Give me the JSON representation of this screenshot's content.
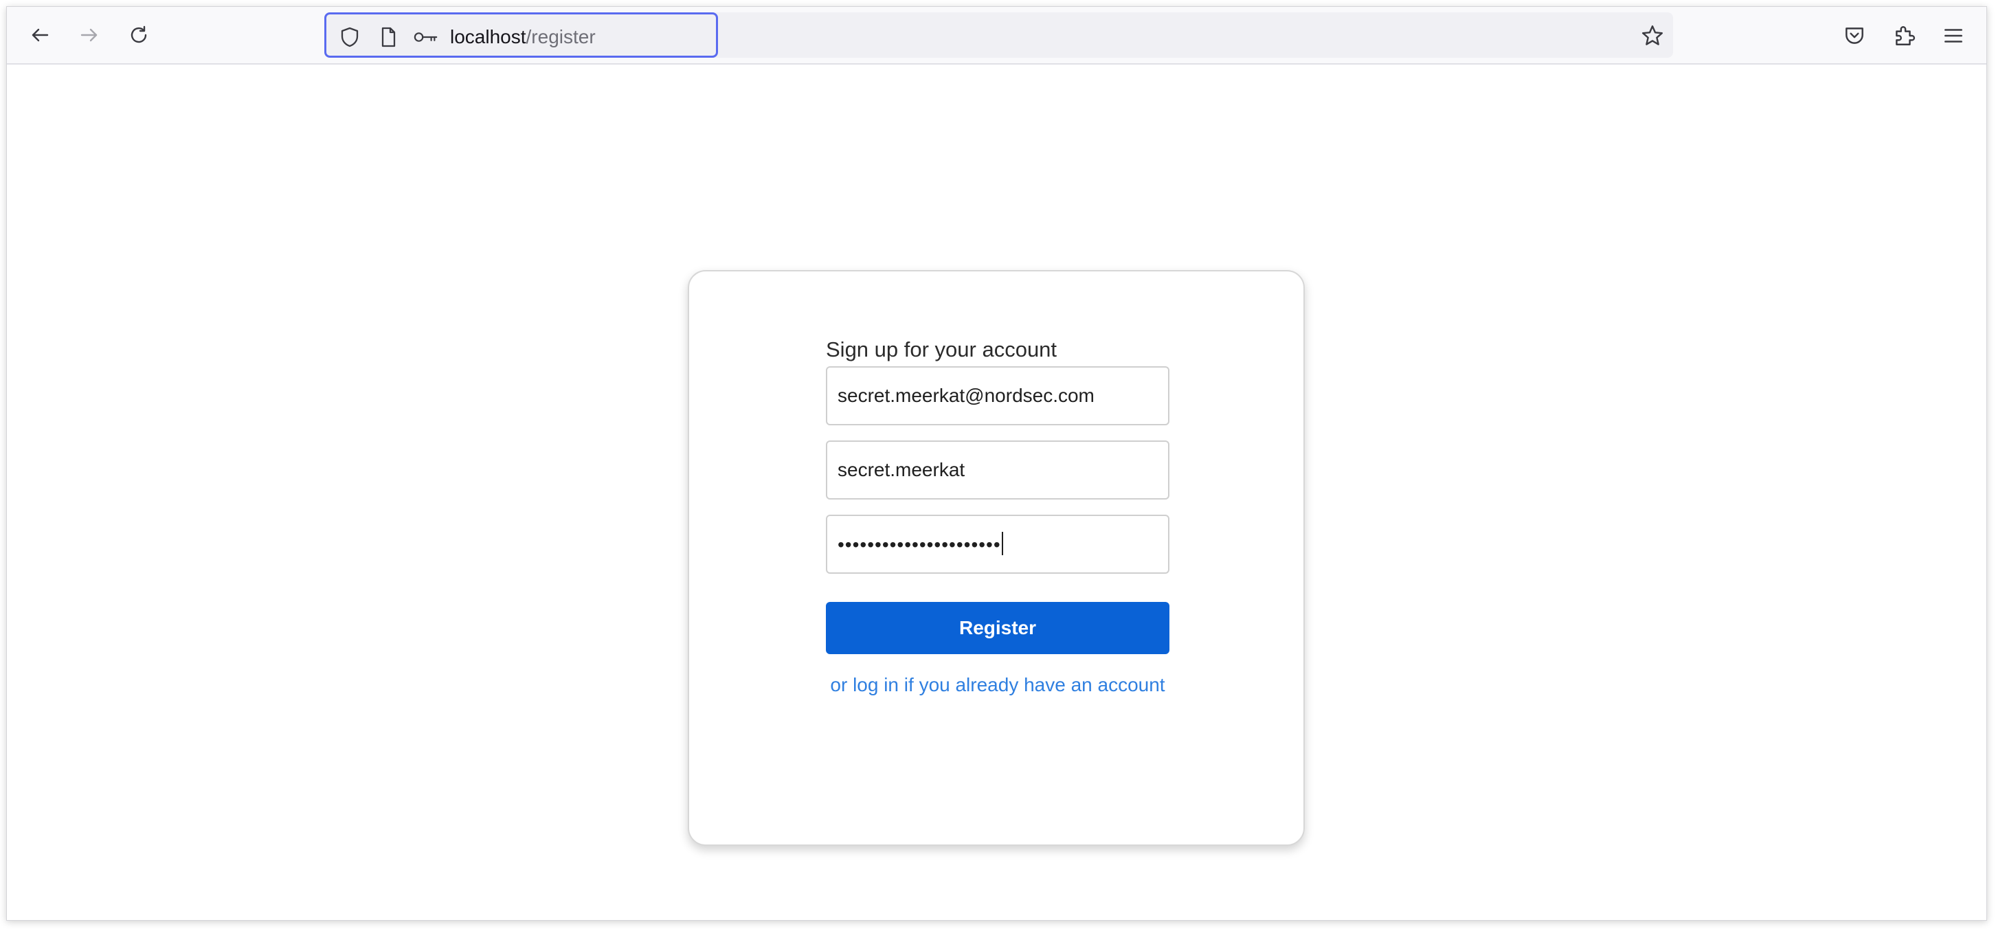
{
  "browser": {
    "url_host": "localhost",
    "url_path": "/register",
    "icons": {
      "back": "back-arrow-icon",
      "forward": "forward-arrow-icon",
      "reload": "reload-icon",
      "tracking_protection": "shield-icon",
      "page_info": "page-icon",
      "saved_logins": "key-icon",
      "bookmark": "star-icon",
      "pocket": "pocket-icon",
      "extensions": "puzzle-icon",
      "menu": "hamburger-menu-icon"
    },
    "focus_color": "#5a6bf0"
  },
  "form": {
    "heading": "Sign up for your account",
    "email_value": "secret.meerkat@nordsec.com",
    "username_value": "secret.meerkat",
    "password_masked": "••••••••••••••••••••••",
    "register_label": "Register",
    "login_link": "or log in if you already have an account",
    "accent_color": "#0a62d6",
    "link_color": "#2f7fe0"
  }
}
